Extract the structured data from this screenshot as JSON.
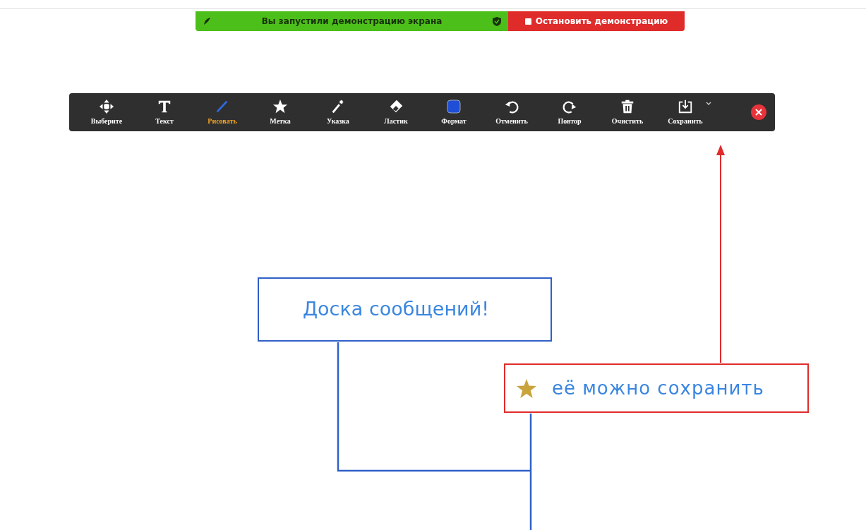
{
  "share_banner": {
    "status": "Вы запустили демонстрацию экрана",
    "stop_button": "Остановить демонстрацию"
  },
  "toolbar": {
    "tools": [
      {
        "kind": "select",
        "label": "Выберите",
        "selected": false
      },
      {
        "kind": "text",
        "label": "Текст",
        "selected": false
      },
      {
        "kind": "draw",
        "label": "Рисовать",
        "selected": true
      },
      {
        "kind": "stamp",
        "label": "Метка",
        "selected": false
      },
      {
        "kind": "spotlight",
        "label": "Указка",
        "selected": false
      },
      {
        "kind": "eraser",
        "label": "Ластик",
        "selected": false
      },
      {
        "kind": "format",
        "label": "Формат",
        "selected": false,
        "color": "#1f4fd6"
      },
      {
        "kind": "undo",
        "label": "Отменить",
        "selected": false
      },
      {
        "kind": "redo",
        "label": "Повтор",
        "selected": false
      },
      {
        "kind": "clear",
        "label": "Очистить",
        "selected": false
      },
      {
        "kind": "save",
        "label": "Сохранить",
        "selected": false
      }
    ]
  },
  "whiteboard": {
    "title_note": "Доска сообщений!",
    "save_note": "её можно сохранить"
  }
}
